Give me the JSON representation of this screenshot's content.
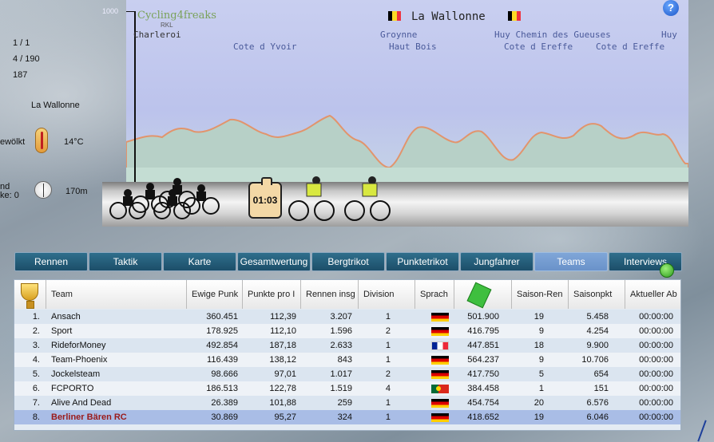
{
  "info": {
    "stage": "1 / 1",
    "rank": "4 / 190",
    "number": "187",
    "region": "La Wallonne",
    "weather": "ewölkt",
    "temperature": "14°C",
    "wind_label": "nd",
    "wind_strength": "ke: 0",
    "altitude": "170m"
  },
  "profile": {
    "axis_max": "1000",
    "logo": "Cycling4freaks",
    "logo_sub": "RKL",
    "title": "La Wallonne",
    "places_top": [
      "Charleroi",
      "Groynne",
      "Huy Chemin des Gueuses",
      "Huy"
    ],
    "places_bottom": [
      "Cote d Yvoir",
      "Haut Bois",
      "Cote d Ereffe",
      "Cote d Ereffe"
    ],
    "help": "?",
    "colors": {
      "be_black": "#000000",
      "be_yellow": "#fdda24",
      "be_red": "#ef3340"
    }
  },
  "race": {
    "clock": "01:03"
  },
  "tabs": [
    {
      "label": "Rennen"
    },
    {
      "label": "Taktik"
    },
    {
      "label": "Karte"
    },
    {
      "label": "Gesamtwertung"
    },
    {
      "label": "Bergtrikot"
    },
    {
      "label": "Punktetrikot"
    },
    {
      "label": "Jungfahrer"
    },
    {
      "label": "Teams",
      "active": true
    },
    {
      "label": "Interviews"
    }
  ],
  "table": {
    "headers": [
      "",
      "Team",
      "Ewige Punk",
      "Punkte pro I",
      "Rennen insg",
      "Division",
      "Sprach",
      "",
      "Saison-Ren",
      "Saisonpkt",
      "Aktueller Ab"
    ],
    "icons": {
      "rank_header": "trophy-icon",
      "money_header": "money-icon"
    },
    "rows": [
      {
        "rank": "1.",
        "team": "Ansach",
        "ewige": "360.451",
        "ppr": "112,39",
        "rennen": "3.207",
        "div": "1",
        "lang": "de",
        "money": "501.900",
        "sr": "19",
        "spkt": "5.458",
        "time": "00:00:00"
      },
      {
        "rank": "2.",
        "team": "Sport",
        "ewige": "178.925",
        "ppr": "112,10",
        "rennen": "1.596",
        "div": "2",
        "lang": "de",
        "money": "416.795",
        "sr": "9",
        "spkt": "4.254",
        "time": "00:00:00"
      },
      {
        "rank": "3.",
        "team": "RideforMoney",
        "ewige": "492.854",
        "ppr": "187,18",
        "rennen": "2.633",
        "div": "1",
        "lang": "fr",
        "money": "447.851",
        "sr": "18",
        "spkt": "9.900",
        "time": "00:00:00"
      },
      {
        "rank": "4.",
        "team": "Team-Phoenix",
        "ewige": "116.439",
        "ppr": "138,12",
        "rennen": "843",
        "div": "1",
        "lang": "de",
        "money": "564.237",
        "sr": "9",
        "spkt": "10.706",
        "time": "00:00:00"
      },
      {
        "rank": "5.",
        "team": "Jockelsteam",
        "ewige": "98.666",
        "ppr": "97,01",
        "rennen": "1.017",
        "div": "2",
        "lang": "de",
        "money": "417.750",
        "sr": "5",
        "spkt": "654",
        "time": "00:00:00"
      },
      {
        "rank": "6.",
        "team": "FCPORTO",
        "ewige": "186.513",
        "ppr": "122,78",
        "rennen": "1.519",
        "div": "4",
        "lang": "pt",
        "money": "384.458",
        "sr": "1",
        "spkt": "151",
        "time": "00:00:00"
      },
      {
        "rank": "7.",
        "team": "Alive And Dead",
        "ewige": "26.389",
        "ppr": "101,88",
        "rennen": "259",
        "div": "1",
        "lang": "de",
        "money": "454.754",
        "sr": "20",
        "spkt": "6.576",
        "time": "00:00:00"
      },
      {
        "rank": "8.",
        "team": "Berliner Bären RC",
        "ewige": "30.869",
        "ppr": "95,27",
        "rennen": "324",
        "div": "1",
        "lang": "de",
        "money": "418.652",
        "sr": "19",
        "spkt": "6.046",
        "time": "00:00:00",
        "highlight": true
      }
    ]
  }
}
